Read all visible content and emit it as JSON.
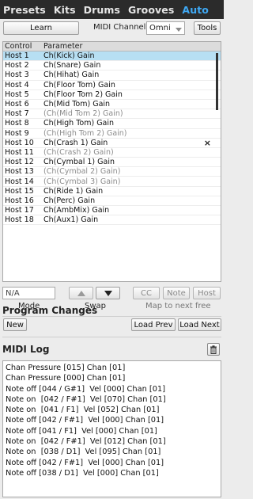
{
  "tabs": [
    {
      "label": "Presets",
      "active": false
    },
    {
      "label": "Kits",
      "active": false
    },
    {
      "label": "Drums",
      "active": false
    },
    {
      "label": "Grooves",
      "active": false
    },
    {
      "label": "Auto",
      "active": true
    }
  ],
  "colors": {
    "active_tab": "#3fa9f5",
    "selected_row": "#b7dff3",
    "tabbar_bg": "#2b2b2b"
  },
  "toolbar": {
    "learn_label": "Learn",
    "midi_channel_label": "MIDI Channel",
    "midi_channel_value": "Omni",
    "tools_label": "Tools"
  },
  "table": {
    "columns": [
      "Control",
      "Parameter"
    ],
    "rows": [
      {
        "control": "Host 1",
        "parameter": "Ch(Kick) Gain",
        "selected": true,
        "dim": false
      },
      {
        "control": "Host 2",
        "parameter": "Ch(Snare) Gain",
        "selected": false,
        "dim": false
      },
      {
        "control": "Host 3",
        "parameter": "Ch(Hihat) Gain",
        "selected": false,
        "dim": false
      },
      {
        "control": "Host 4",
        "parameter": "Ch(Floor Tom) Gain",
        "selected": false,
        "dim": false
      },
      {
        "control": "Host 5",
        "parameter": "Ch(Floor Tom 2) Gain",
        "selected": false,
        "dim": false
      },
      {
        "control": "Host 6",
        "parameter": "Ch(Mid Tom) Gain",
        "selected": false,
        "dim": false
      },
      {
        "control": "Host 7",
        "parameter": "(Ch(Mid Tom 2) Gain)",
        "selected": false,
        "dim": true
      },
      {
        "control": "Host 8",
        "parameter": "Ch(High Tom) Gain",
        "selected": false,
        "dim": false
      },
      {
        "control": "Host 9",
        "parameter": "(Ch(High Tom 2) Gain)",
        "selected": false,
        "dim": true
      },
      {
        "control": "Host 10",
        "parameter": "Ch(Crash 1) Gain",
        "selected": false,
        "dim": false,
        "remove": "×"
      },
      {
        "control": "Host 11",
        "parameter": "(Ch(Crash 2) Gain)",
        "selected": false,
        "dim": true
      },
      {
        "control": "Host 12",
        "parameter": "Ch(Cymbal 1) Gain",
        "selected": false,
        "dim": false
      },
      {
        "control": "Host 13",
        "parameter": "(Ch(Cymbal 2) Gain)",
        "selected": false,
        "dim": true
      },
      {
        "control": "Host 14",
        "parameter": "(Ch(Cymbal 3) Gain)",
        "selected": false,
        "dim": true
      },
      {
        "control": "Host 15",
        "parameter": "Ch(Ride 1) Gain",
        "selected": false,
        "dim": false
      },
      {
        "control": "Host 16",
        "parameter": "Ch(Perc) Gain",
        "selected": false,
        "dim": false
      },
      {
        "control": "Host 17",
        "parameter": "Ch(AmbMix) Gain",
        "selected": false,
        "dim": false
      },
      {
        "control": "Host 18",
        "parameter": "Ch(Aux1) Gain",
        "selected": false,
        "dim": false
      }
    ]
  },
  "mapping": {
    "field_value": "N/A",
    "mode_label": "Mode",
    "swap_label": "Swap",
    "cc_label": "CC",
    "note_label": "Note",
    "host_label": "Host",
    "map_next_label": "Map to next free"
  },
  "program_changes": {
    "title": "Program Changes",
    "new_label": "New",
    "load_prev_label": "Load Prev",
    "load_next_label": "Load Next"
  },
  "midi_log": {
    "title": "MIDI Log",
    "lines": [
      "Chan Pressure [015] Chan [01]",
      "Chan Pressure [000] Chan [01]",
      "Note off [044 / G#1]  Vel [000] Chan [01]",
      "Note on  [042 / F#1]  Vel [070] Chan [01]",
      "Note on  [041 / F1]  Vel [052] Chan [01]",
      "Note off [042 / F#1]  Vel [000] Chan [01]",
      "Note off [041 / F1]  Vel [000] Chan [01]",
      "Note on  [042 / F#1]  Vel [012] Chan [01]",
      "Note on  [038 / D1]  Vel [095] Chan [01]",
      "Note off [042 / F#1]  Vel [000] Chan [01]",
      "Note off [038 / D1]  Vel [000] Chan [01]"
    ]
  }
}
